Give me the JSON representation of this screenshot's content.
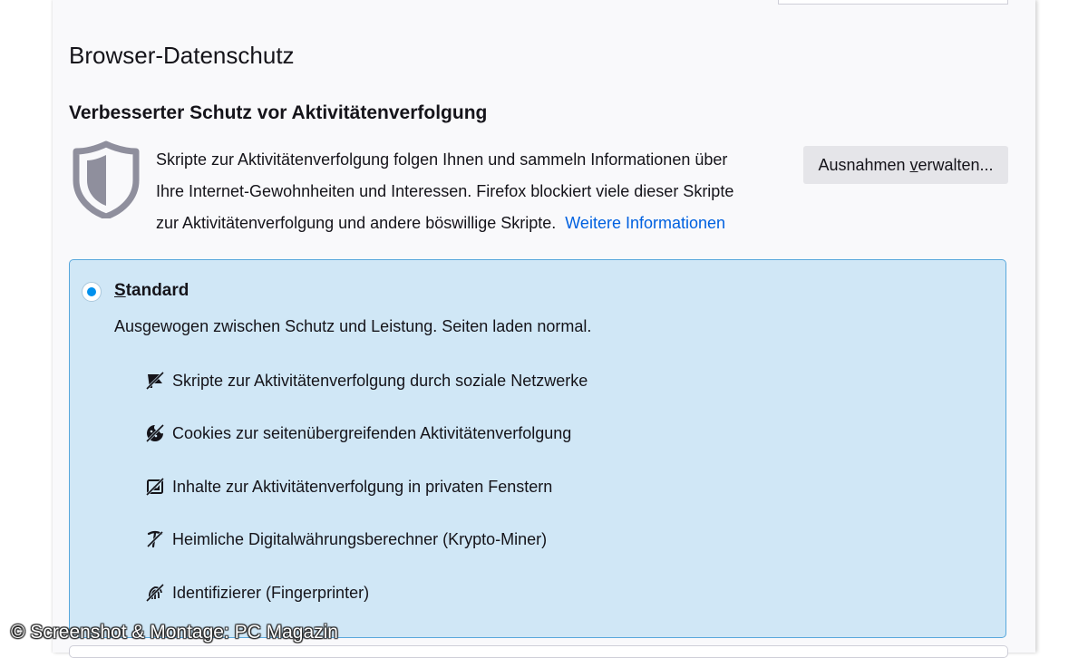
{
  "section": {
    "title": "Browser-Datenschutz",
    "subtitle": "Verbesserter Schutz vor Aktivitätenverfolgung",
    "description_lines": [
      "Skripte zur Aktivitätenverfolgung folgen Ihnen und sammeln Informationen über",
      "Ihre Internet-Gewohnheiten und Interessen. Firefox blockiert viele dieser Skripte",
      "zur Aktivitätenverfolgung und andere böswillige Skripte."
    ],
    "more_link": "Weitere Informationen",
    "exceptions_button": {
      "prefix": "Ausnahmen ",
      "underlined": "v",
      "suffix": "erwalten..."
    }
  },
  "standard_option": {
    "selected": true,
    "label_underlined": "S",
    "label_rest": "tandard",
    "description": "Ausgewogen zwischen Schutz und Leistung. Seiten laden normal.",
    "blocked_items": [
      {
        "icon": "social-tracker-icon",
        "label": "Skripte zur Aktivitätenverfolgung durch soziale Netzwerke"
      },
      {
        "icon": "cookie-blocked-icon",
        "label": "Cookies zur seitenübergreifenden Aktivitätenverfolgung"
      },
      {
        "icon": "tracking-content-icon",
        "label": "Inhalte zur Aktivitätenverfolgung in privaten Fenstern"
      },
      {
        "icon": "cryptominer-icon",
        "label": "Heimliche Digitalwährungsberechner (Krypto-Miner)"
      },
      {
        "icon": "fingerprinter-icon",
        "label": "Identifizierer (Fingerprinter)"
      }
    ]
  },
  "watermark": "© Screenshot & Montage: PC Magazin",
  "colors": {
    "accent": "#0090ed",
    "link": "#0061e0",
    "card_background": "#d0e7f6",
    "card_border": "#59a8dc",
    "button_background": "#e5e5e9"
  }
}
